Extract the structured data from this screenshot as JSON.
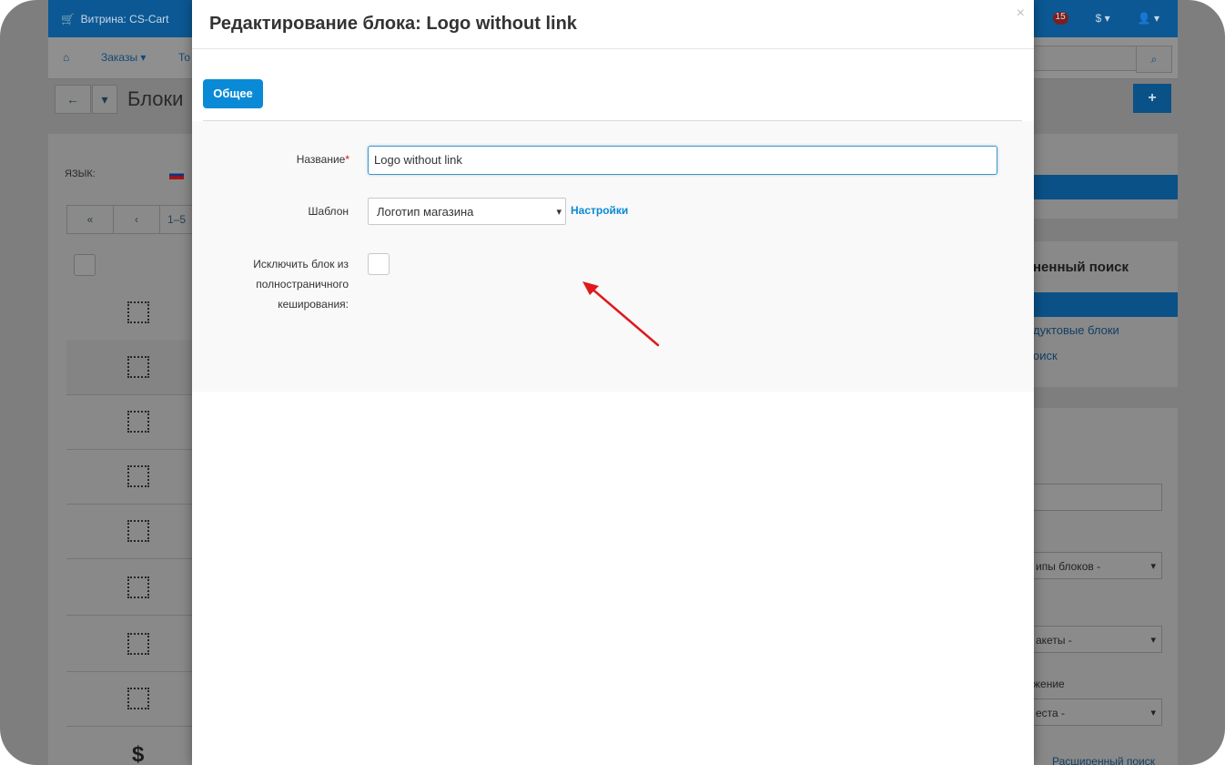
{
  "background": {
    "topbar": {
      "store_label": "Витрина: CS-Cart",
      "notif_count": "15",
      "currency": "$ ▾",
      "user": "▾"
    },
    "nav": {
      "orders": "Заказы ▾",
      "products": "То"
    },
    "page_title": "Блоки",
    "language_label": "ЯЗЫК:",
    "pager": {
      "first": "«",
      "prev": "‹",
      "range": "1–5"
    },
    "price_icon": "$",
    "right_panel": {
      "heading": "ненный поиск",
      "link_product_blocks": "дуктовые блоки",
      "link_search": "оиск",
      "select_block_types": "ипы блоков -",
      "select_layouts": "акеты -",
      "position_label": "жение",
      "select_places": "еста -",
      "advanced_search": "Расширенный поиск"
    },
    "accent_color": "#0a5187"
  },
  "modal": {
    "title": "Редактирование блока: Logo without link",
    "close_symbol": "×",
    "tabs": [
      {
        "label": "Общее",
        "active": true
      }
    ],
    "fields": {
      "name_label": "Название",
      "name_required_mark": "*",
      "name_value": "Logo without link",
      "template_label": "Шаблон",
      "template_value": "Логотип магазина",
      "settings_link": "Настройки",
      "exclude_label_line1": "Исключить блок из",
      "exclude_label_line2": "полностраничного",
      "exclude_label_line3": "кеширования:",
      "exclude_checked": false
    },
    "accent_color": "#0a8ad6"
  }
}
